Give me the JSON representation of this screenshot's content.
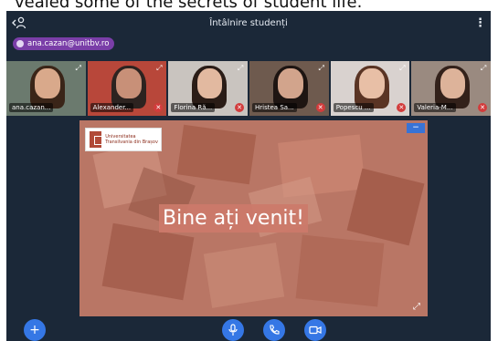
{
  "caption": "vealed some of the secrets of student life.",
  "meeting": {
    "title": "Întâlnire studenți",
    "user_email": "ana.cazan@unitbv.ro"
  },
  "participants": [
    {
      "name": "ana.cazan..."
    },
    {
      "name": "Alexander..."
    },
    {
      "name": "Florina Ră..."
    },
    {
      "name": "Hristea Sa..."
    },
    {
      "name": "Popescu ..."
    },
    {
      "name": "Valeria-M..."
    }
  ],
  "presentation": {
    "logo_text": "Universitatea Transilvania din Brașov",
    "slide_text": "Bine ați venit!"
  },
  "icons": {
    "users": "users-icon",
    "more": "more-vertical-icon",
    "plus": "plus-icon",
    "mic": "microphone-icon",
    "phone": "phone-icon",
    "video": "video-camera-icon",
    "expand": "fullscreen-icon",
    "mute": "muted-icon"
  },
  "colors": {
    "app_bg": "#1b2838",
    "accent": "#3577e5",
    "badge": "#7a3ea8",
    "slide_bg": "#b97665",
    "mute": "#d23c3c"
  }
}
